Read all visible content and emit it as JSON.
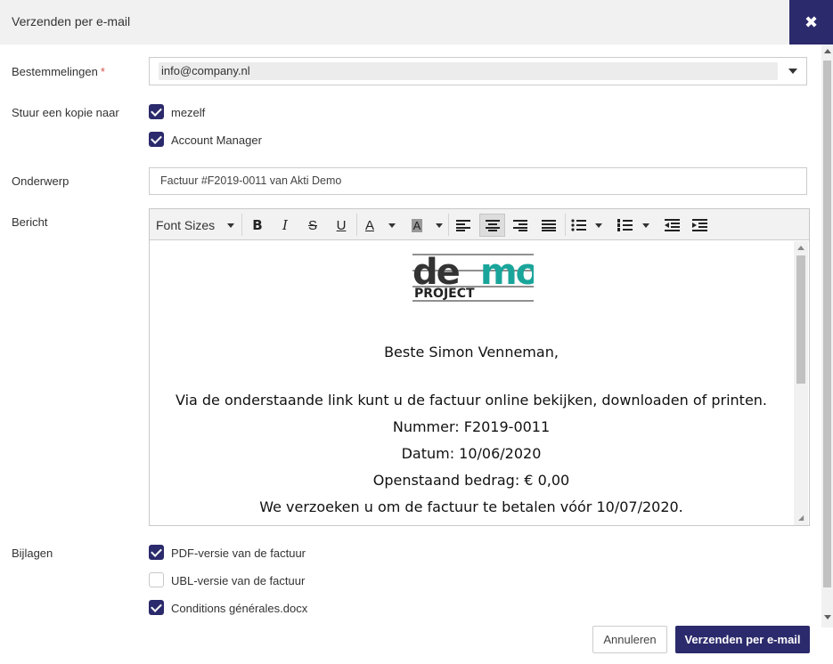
{
  "modal": {
    "title": "Verzenden per e-mail",
    "close_icon": "close-icon"
  },
  "recipients": {
    "label": "Bestemmelingen",
    "required_mark": "*",
    "value": "info@company.nl"
  },
  "copy": {
    "label": "Stuur een kopie naar",
    "options": [
      {
        "label": "mezelf",
        "checked": true
      },
      {
        "label": "Account Manager",
        "checked": true
      }
    ]
  },
  "subject": {
    "label": "Onderwerp",
    "value": "Factuur #F2019-0011 van Akti Demo"
  },
  "message": {
    "label": "Bericht",
    "toolbar": {
      "font_sizes": "Font Sizes",
      "bold": "B",
      "italic": "I",
      "strike": "S",
      "underline": "U",
      "font_color": "A",
      "bg_color": "A"
    },
    "logo": {
      "line1": "demo",
      "line2": "project"
    },
    "greeting": "Beste  Simon Venneman,",
    "lines": [
      "Via de onderstaande link kunt u de factuur online bekijken, downloaden of printen.",
      "Nummer: F2019-0011",
      "Datum: 10/06/2020",
      "Openstaand bedrag: € 0,00",
      "We verzoeken u om de factuur te betalen vóór 10/07/2020."
    ]
  },
  "attachments": {
    "label": "Bijlagen",
    "items": [
      {
        "label": "PDF-versie van de factuur",
        "checked": true
      },
      {
        "label": "UBL-versie van de factuur",
        "checked": false
      },
      {
        "label": "Conditions générales.docx",
        "checked": true
      }
    ]
  },
  "actions": {
    "cancel": "Annuleren",
    "send": "Verzenden per e-mail"
  },
  "colors": {
    "primary": "#2b2a6c",
    "logo_accent": "#1aa59b",
    "required": "#d9534f"
  }
}
